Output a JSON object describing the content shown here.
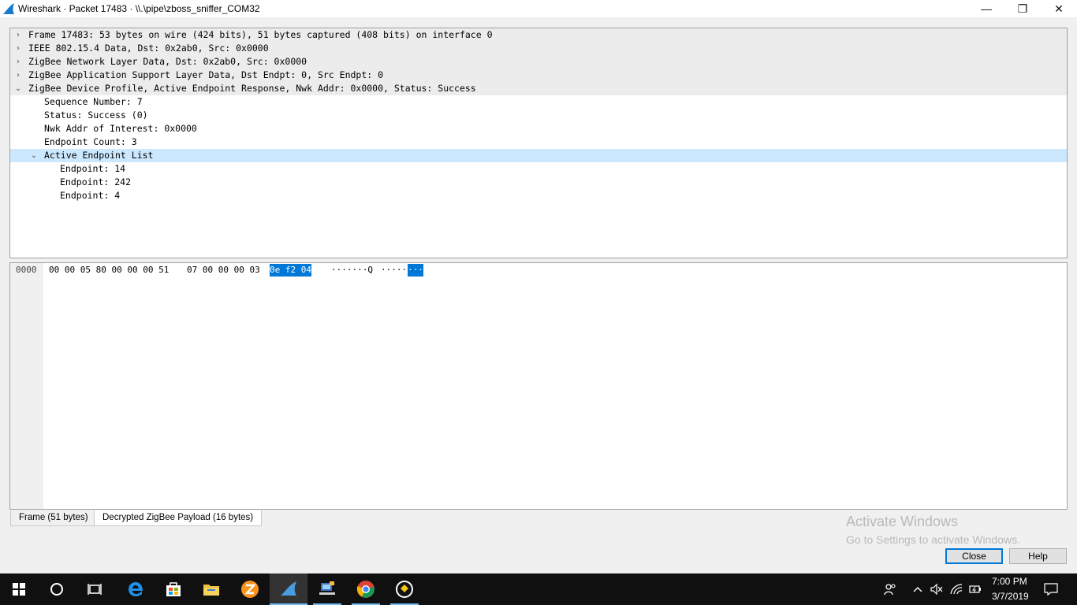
{
  "window": {
    "title": "Wireshark · Packet 17483 · \\\\.\\pipe\\zboss_sniffer_COM32",
    "minimize_glyph": "—",
    "maximize_glyph": "❐",
    "close_glyph": "✕"
  },
  "tree": {
    "rows": [
      {
        "text": "Frame 17483: 53 bytes on wire (424 bits), 51 bytes captured (408 bits) on interface 0",
        "arrow": "›",
        "expanded": false
      },
      {
        "text": "IEEE 802.15.4 Data, Dst: 0x2ab0, Src: 0x0000",
        "arrow": "›",
        "expanded": false
      },
      {
        "text": "ZigBee Network Layer Data, Dst: 0x2ab0, Src: 0x0000",
        "arrow": "›",
        "expanded": false
      },
      {
        "text": "ZigBee Application Support Layer Data, Dst Endpt: 0, Src Endpt: 0",
        "arrow": "›",
        "expanded": false
      },
      {
        "text": "ZigBee Device Profile, Active Endpoint Response, Nwk Addr: 0x0000, Status: Success",
        "arrow": "⌄",
        "expanded": true
      },
      {
        "text": "Sequence Number: 7"
      },
      {
        "text": "Status: Success (0)"
      },
      {
        "text": "Nwk Addr of Interest: 0x0000"
      },
      {
        "text": "Endpoint Count: 3"
      },
      {
        "text": "Active Endpoint List",
        "arrow": "⌄",
        "expanded": true,
        "selected": true
      },
      {
        "text": "Endpoint: 14"
      },
      {
        "text": "Endpoint: 242"
      },
      {
        "text": "Endpoint: 4"
      }
    ]
  },
  "hex": {
    "offset": "0000",
    "bytes_a": "00 00 05 80 00 00 00 51",
    "bytes_b": "07 00 00 00 03",
    "bytes_sel": "0e f2 04",
    "ascii_a": "·······Q",
    "ascii_b": "·····",
    "ascii_sel": "···"
  },
  "tabs": {
    "frame": "Frame (51 bytes)",
    "decrypted": "Decrypted ZigBee Payload (16 bytes)"
  },
  "watermark": {
    "line1": "Activate Windows",
    "line2": "Go to Settings to activate Windows."
  },
  "buttons": {
    "close": "Close",
    "help": "Help"
  },
  "taskbar": {
    "time": "7:00 PM",
    "date": "3/7/2019",
    "accent": "#76b9ed"
  },
  "colors": {
    "selection": "#0078d7",
    "tree_selected": "#cce8ff"
  }
}
